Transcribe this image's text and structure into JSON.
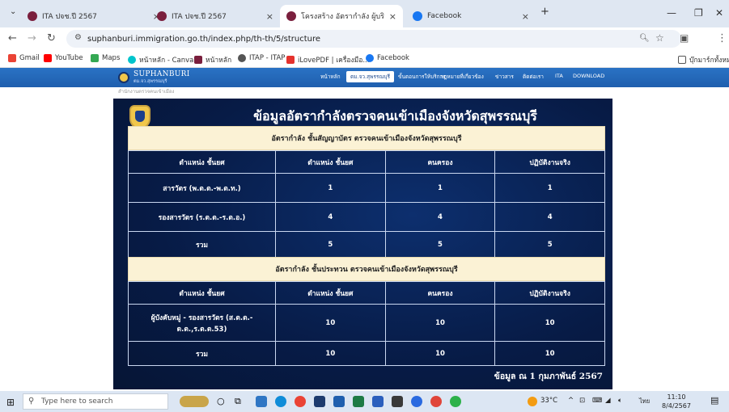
{
  "browser": {
    "tabs": [
      {
        "label": "ITA ปจช.ปี 2567",
        "active": false
      },
      {
        "label": "ITA ปจช.ปี 2567",
        "active": false
      },
      {
        "label": "โครงสร้าง อัตรากำลัง ผู้บริหาร",
        "active": true
      },
      {
        "label": "Facebook",
        "active": false
      }
    ],
    "new_tab": "+",
    "url": "suphanburi.immigration.go.th/index.php/th-th/5/structure",
    "bookmarks": [
      {
        "label": "Gmail",
        "color": "#ea4335"
      },
      {
        "label": "YouTube",
        "color": "#ff0000"
      },
      {
        "label": "Maps",
        "color": "#34a853"
      },
      {
        "label": "หน้าหลัก - Canva",
        "color": "#00c4cc"
      },
      {
        "label": "หน้าหลัก",
        "color": "#7a1f3d"
      },
      {
        "label": "ITAP - ITAP",
        "color": "#555555"
      },
      {
        "label": "iLovePDF | เครื่องมือ...",
        "color": "#e5322d"
      },
      {
        "label": "Facebook",
        "color": "#1877f2"
      }
    ],
    "all_bookmarks": "บุ๊กมาร์กทั้งหมด"
  },
  "site": {
    "name": "SUPHANBURI",
    "tagline": "ตม.จว.สุพรรณบุรี",
    "menu": [
      {
        "label": "หน้าหลัก",
        "active": false
      },
      {
        "label": "ตม.จว.สุพรรณบุรี",
        "active": true
      },
      {
        "label": "ขั้นตอนการให้บริการ",
        "active": false
      },
      {
        "label": "กฎหมายที่เกี่ยวข้อง",
        "active": false
      },
      {
        "label": "ข่าวสาร",
        "active": false
      },
      {
        "label": "ติดต่อเรา",
        "active": false
      },
      {
        "label": "ITA",
        "active": false
      },
      {
        "label": "DOWNLOAD",
        "active": false
      }
    ],
    "subline": "สำนักงานตรวจคนเข้าเมือง"
  },
  "infographic": {
    "title": "ข้อมูลอัตรากำลังตรวจคนเข้าเมืองจังหวัดสุพรรณบุรี",
    "sections": [
      {
        "heading": "อัตรากำลัง ชั้นสัญญาบัตร ตรวจคนเข้าเมืองจังหวัดสุพรรณบุรี",
        "columns": [
          "ตำแหน่ง ชั้นยศ",
          "ตำแหน่ง ชั้นยศ",
          "คนครอง",
          "ปฏิบัติงานจริง"
        ],
        "rows": [
          [
            "สารวัตร (พ.ต.ต.-พ.ต.ท.)",
            "1",
            "1",
            "1"
          ],
          [
            "รองสารวัตร (ร.ต.ต.-ร.ต.อ.)",
            "4",
            "4",
            "4"
          ],
          [
            "รวม",
            "5",
            "5",
            "5"
          ]
        ]
      },
      {
        "heading": "อัตรากำลัง ชั้นประทวน ตรวจคนเข้าเมืองจังหวัดสุพรรณบุรี",
        "columns": [
          "ตำแหน่ง ชั้นยศ",
          "ตำแหน่ง ชั้นยศ",
          "คนครอง",
          "ปฏิบัติงานจริง"
        ],
        "rows": [
          [
            "ผู้บังคับหมู่ - รองสารวัตร (ส.ต.ต.-ด.ต.,ร.ต.ต.53)",
            "10",
            "10",
            "10"
          ],
          [
            "รวม",
            "10",
            "10",
            "10"
          ]
        ]
      }
    ],
    "footnote": "ข้อมูล ณ 1 กุมภาพันธ์ 2567"
  },
  "taskbar": {
    "search_placeholder": "Type here to search",
    "temperature": "33°C",
    "language": "ไทย",
    "time": "11:10",
    "date": "8/4/2567"
  }
}
